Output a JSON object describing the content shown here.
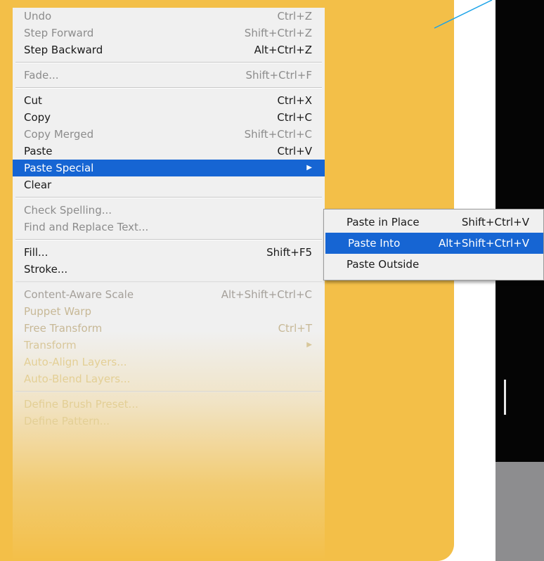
{
  "menu": {
    "groups": [
      [
        {
          "label": "Undo",
          "shortcut": "Ctrl+Z",
          "state": "disabled"
        },
        {
          "label": "Step Forward",
          "shortcut": "Shift+Ctrl+Z",
          "state": "disabled"
        },
        {
          "label": "Step Backward",
          "shortcut": "Alt+Ctrl+Z",
          "state": "enabled"
        }
      ],
      [
        {
          "label": "Fade...",
          "shortcut": "Shift+Ctrl+F",
          "state": "disabled"
        }
      ],
      [
        {
          "label": "Cut",
          "shortcut": "Ctrl+X",
          "state": "enabled"
        },
        {
          "label": "Copy",
          "shortcut": "Ctrl+C",
          "state": "enabled"
        },
        {
          "label": "Copy Merged",
          "shortcut": "Shift+Ctrl+C",
          "state": "disabled"
        },
        {
          "label": "Paste",
          "shortcut": "Ctrl+V",
          "state": "enabled"
        },
        {
          "label": "Paste Special",
          "shortcut": "",
          "state": "highlighted",
          "submenu": true
        },
        {
          "label": "Clear",
          "shortcut": "",
          "state": "enabled"
        }
      ],
      [
        {
          "label": "Check Spelling...",
          "shortcut": "",
          "state": "disabled"
        },
        {
          "label": "Find and Replace Text...",
          "shortcut": "",
          "state": "disabled"
        }
      ],
      [
        {
          "label": "Fill...",
          "shortcut": "Shift+F5",
          "state": "enabled"
        },
        {
          "label": "Stroke...",
          "shortcut": "",
          "state": "enabled"
        }
      ],
      [
        {
          "label": "Content-Aware Scale",
          "shortcut": "Alt+Shift+Ctrl+C",
          "state": "faded1"
        },
        {
          "label": "Puppet Warp",
          "shortcut": "",
          "state": "faded2"
        },
        {
          "label": "Free Transform",
          "shortcut": "Ctrl+T",
          "state": "faded2"
        },
        {
          "label": "Transform",
          "shortcut": "",
          "state": "faded3",
          "submenu": true
        },
        {
          "label": "Auto-Align Layers...",
          "shortcut": "",
          "state": "faded4"
        },
        {
          "label": "Auto-Blend Layers...",
          "shortcut": "",
          "state": "faded4"
        }
      ],
      [
        {
          "label": "Define Brush Preset...",
          "shortcut": "",
          "state": "faded4"
        },
        {
          "label": "Define Pattern...",
          "shortcut": "",
          "state": "faded4"
        }
      ]
    ],
    "submenu_arrow": "▶"
  },
  "submenu": {
    "items": [
      {
        "label": "Paste in Place",
        "shortcut": "Shift+Ctrl+V",
        "state": "enabled"
      },
      {
        "label": "Paste Into",
        "shortcut": "Alt+Shift+Ctrl+V",
        "state": "highlighted"
      },
      {
        "label": "Paste Outside",
        "shortcut": "",
        "state": "enabled"
      }
    ]
  },
  "colors": {
    "panel_yellow": "#f3bf48",
    "highlight_blue": "#1665d3",
    "menu_bg": "#f0f0f0",
    "accent_cyan": "#1aa3e8",
    "dark_area": "#050505",
    "gray_area": "#8d8d8f"
  }
}
